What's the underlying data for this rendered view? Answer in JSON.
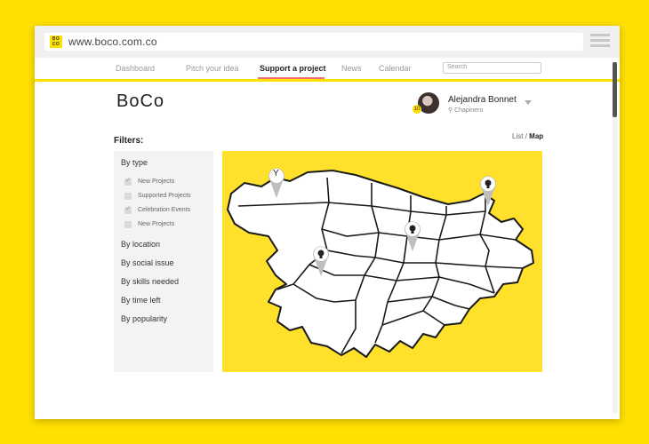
{
  "browser": {
    "url": "www.boco.com.co",
    "favicon_text": "BO CO"
  },
  "nav": {
    "items": [
      {
        "label": "Dashboard"
      },
      {
        "label": "Pitch your idea"
      },
      {
        "label": "Support a project",
        "active": true
      },
      {
        "label": "News"
      },
      {
        "label": "Calendar"
      }
    ],
    "search_placeholder": "Search"
  },
  "header": {
    "logo": "BoCo",
    "user": {
      "name": "Alejandra Bonnet",
      "location": "Chapinero",
      "notification_count": "10"
    }
  },
  "filters": {
    "title": "Filters:",
    "by_type": "By type",
    "checkboxes": [
      {
        "label": "New Projects",
        "checked": true
      },
      {
        "label": "Supported Projects",
        "checked": false
      },
      {
        "label": "Celebration Events",
        "checked": true
      },
      {
        "label": "New Projects",
        "checked": false
      }
    ],
    "groups": [
      "By location",
      "By social issue",
      "By skills needed",
      "By time left",
      "By popularity"
    ]
  },
  "view_toggle": {
    "list": "List",
    "separator": "/",
    "map": "Map"
  },
  "map": {
    "pins": [
      {
        "icon": "cocktail-glass-icon"
      },
      {
        "icon": "lightbulb-icon"
      },
      {
        "icon": "lightbulb-icon"
      },
      {
        "icon": "lightbulb-icon"
      }
    ]
  },
  "colors": {
    "brand_yellow": "#ffe000",
    "active_tab_underline": "#f06b6b",
    "map_background": "#ffe02a"
  }
}
